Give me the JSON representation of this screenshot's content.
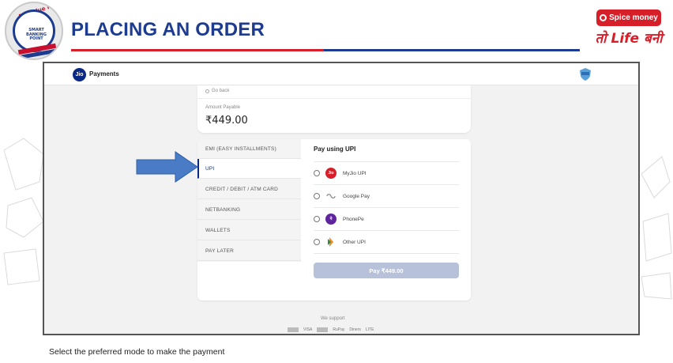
{
  "slide": {
    "title": "PLACING AN ORDER",
    "caption": "Select the preferred mode to make the payment"
  },
  "logo": {
    "ring_text": "Red Blue Revolution",
    "center_text": "SMART BANKING POINT"
  },
  "brand": {
    "name": "Spice money",
    "tagline": "तो Life बनी"
  },
  "app": {
    "logo_text": "Jio",
    "title": "Payments"
  },
  "amount": {
    "back_label": "Go back",
    "label": "Amount Payable",
    "value": "₹449.00"
  },
  "methods": [
    {
      "label": "EMI (EASY INSTALLMENTS)",
      "active": false
    },
    {
      "label": "UPI",
      "active": true
    },
    {
      "label": "CREDIT / DEBIT / ATM CARD",
      "active": false
    },
    {
      "label": "NETBANKING",
      "active": false
    },
    {
      "label": "WALLETS",
      "active": false
    },
    {
      "label": "PAY LATER",
      "active": false
    }
  ],
  "upi": {
    "title": "Pay using UPI",
    "options": [
      {
        "name": "MyJio UPI",
        "icon": "jio-icon",
        "icon_text": "Jio",
        "color": "#d71f2a"
      },
      {
        "name": "Google Pay",
        "icon": "google-pay-icon",
        "icon_text": "",
        "color": "#ffffff"
      },
      {
        "name": "PhonePe",
        "icon": "phonepe-icon",
        "icon_text": "पे",
        "color": "#5f259f"
      },
      {
        "name": "Other UPI",
        "icon": "upi-icon",
        "icon_text": "",
        "color": "#ffffff"
      }
    ],
    "pay_button": "Pay ₹449.00"
  },
  "footer": {
    "we_support": "We support",
    "logos": [
      "VISA",
      "RuPay",
      "Diners",
      "LITE"
    ]
  },
  "colors": {
    "title_blue": "#1d3c8f",
    "brand_red": "#d71f2a",
    "arrow_blue": "#4a7cc6",
    "jio_blue": "#0a2885"
  }
}
